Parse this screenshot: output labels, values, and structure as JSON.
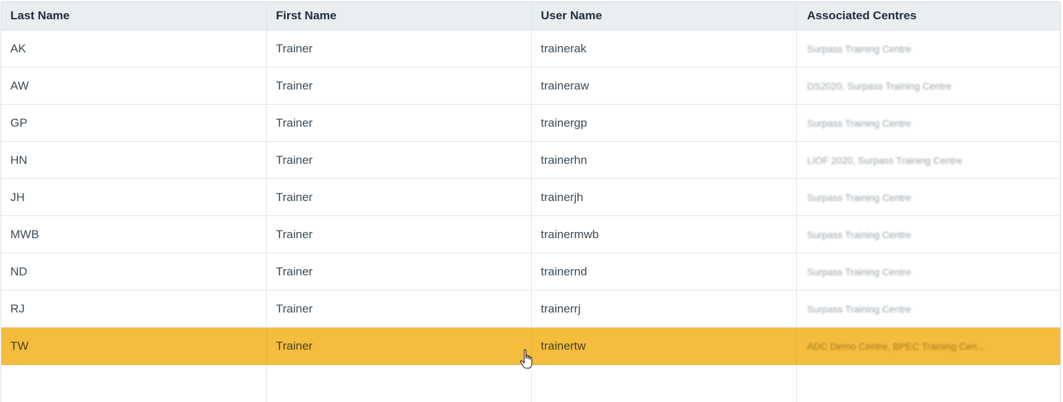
{
  "table": {
    "columns": [
      "Last Name",
      "First Name",
      "User Name",
      "Associated Centres"
    ],
    "rows": [
      {
        "last_name": "AK",
        "first_name": "Trainer",
        "user_name": "trainerak",
        "centres": "Surpass Training Centre"
      },
      {
        "last_name": "AW",
        "first_name": "Trainer",
        "user_name": "traineraw",
        "centres": "DS2020, Surpass Training Centre"
      },
      {
        "last_name": "GP",
        "first_name": "Trainer",
        "user_name": "trainergp",
        "centres": "Surpass Training Centre"
      },
      {
        "last_name": "HN",
        "first_name": "Trainer",
        "user_name": "trainerhn",
        "centres": "LIOF 2020, Surpass Training Centre"
      },
      {
        "last_name": "JH",
        "first_name": "Trainer",
        "user_name": "trainerjh",
        "centres": "Surpass Training Centre"
      },
      {
        "last_name": "MWB",
        "first_name": "Trainer",
        "user_name": "trainermwb",
        "centres": "Surpass Training Centre"
      },
      {
        "last_name": "ND",
        "first_name": "Trainer",
        "user_name": "trainernd",
        "centres": "Surpass Training Centre"
      },
      {
        "last_name": "RJ",
        "first_name": "Trainer",
        "user_name": "trainerrj",
        "centres": "Surpass Training Centre"
      },
      {
        "last_name": "TW",
        "first_name": "Trainer",
        "user_name": "trainertw",
        "centres": "ADC Demo Centre, BPEC Training Cen..."
      }
    ],
    "selected_row_index": 8,
    "colors": {
      "header_bg": "#e9eef1",
      "selected_bg": "#f4bd3e",
      "border": "#dfe5ea"
    }
  },
  "cursor": {
    "icon": "hand-pointer-icon"
  }
}
